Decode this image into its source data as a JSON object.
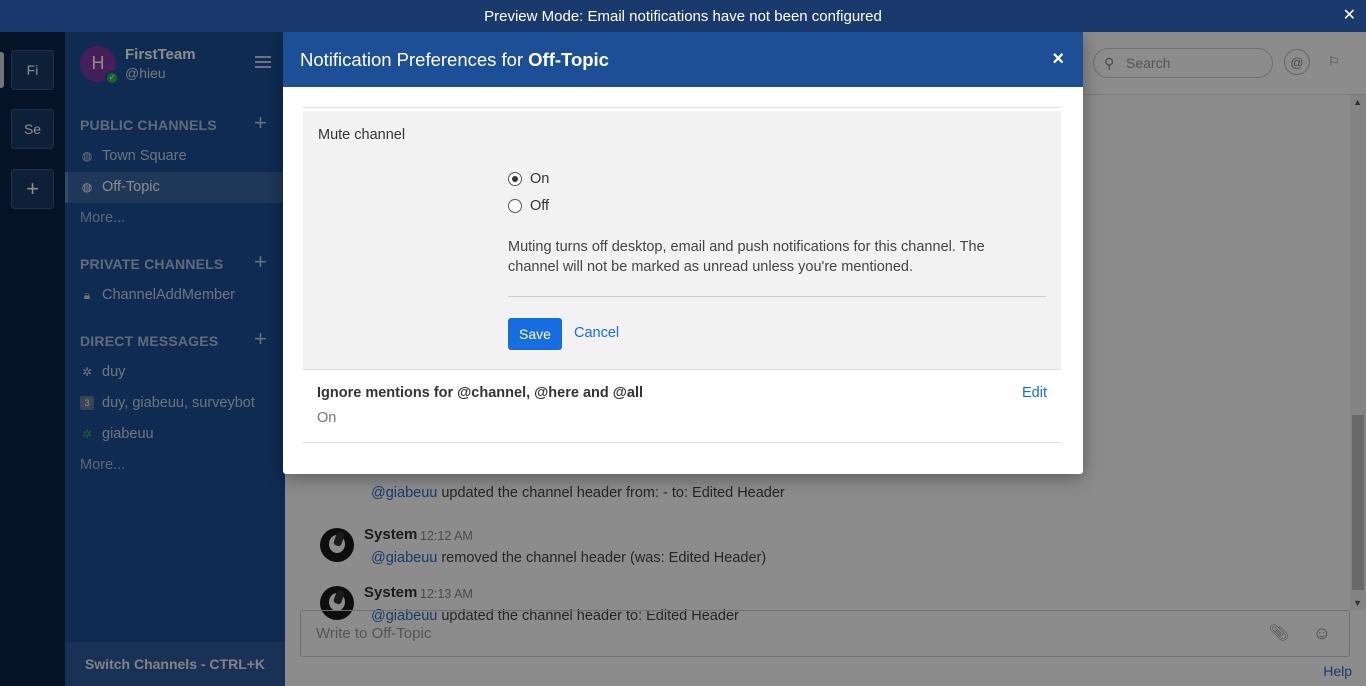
{
  "banner": {
    "text": "Preview Mode: Email notifications have not been configured",
    "close": "✕"
  },
  "teams": [
    {
      "initials": "Fi"
    },
    {
      "initials": "Se"
    }
  ],
  "add_team": "+",
  "sidebar": {
    "team_name": "FirstTeam",
    "username": "@hieu",
    "avatar_letter": "H",
    "public_title": "PUBLIC CHANNELS",
    "public_channels": [
      "Town Square",
      "Off-Topic"
    ],
    "public_more": "More...",
    "private_title": "PRIVATE CHANNELS",
    "private_channels": [
      "ChannelAddMember"
    ],
    "dm_title": "DIRECT MESSAGES",
    "dms": [
      "duy",
      "duy, giabeuu, surveybot",
      "giabeuu"
    ],
    "dm_group_count": "3",
    "dm_more": "More...",
    "footer": "Switch Channels - CTRL+K",
    "plus": "+"
  },
  "header": {
    "search_placeholder": "Search",
    "mention_icon": "@",
    "flag_icon": "⚐"
  },
  "posts": [
    {
      "author": "System",
      "time": "12:12 AM",
      "mention": "@giabeuu",
      "text": " updated the channel header from: - to: Edited Header"
    },
    {
      "author": "System",
      "time": "12:12 AM",
      "mention": "@giabeuu",
      "text": " removed the channel header (was: Edited Header)"
    },
    {
      "author": "System",
      "time": "12:13 AM",
      "mention": "@giabeuu",
      "text": " updated the channel header to: Edited Header"
    }
  ],
  "composer": {
    "placeholder": "Write to Off-Topic"
  },
  "help": "Help",
  "modal": {
    "title_prefix": "Notification Preferences for",
    "channel": "Off-Topic",
    "close": "×",
    "mute_title": "Mute channel",
    "options": [
      "On",
      "Off"
    ],
    "selected": "On",
    "mute_help": "Muting turns off desktop, email and push notifications for this channel. The channel will not be marked as unread unless you're mentioned.",
    "save": "Save",
    "cancel": "Cancel",
    "ignore_title": "Ignore mentions for @channel, @here and @all",
    "ignore_value": "On",
    "edit": "Edit"
  }
}
